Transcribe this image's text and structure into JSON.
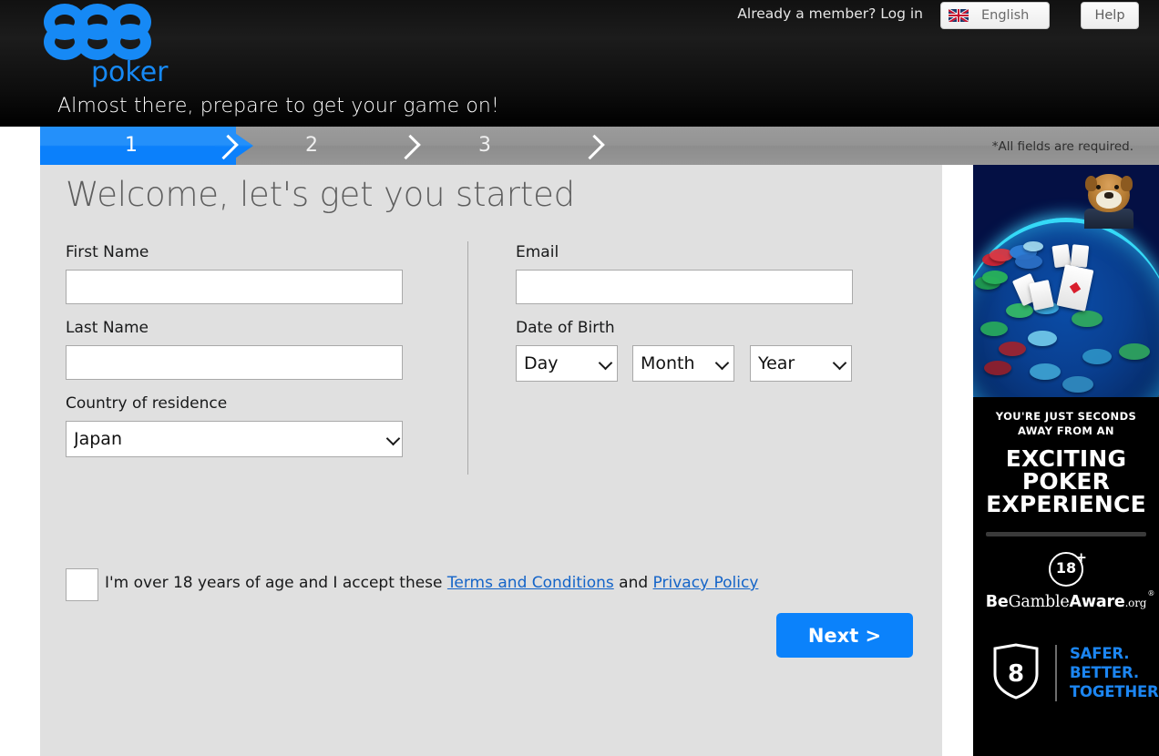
{
  "header": {
    "logo_digits": "888",
    "logo_word": "poker",
    "tagline": "Almost there, prepare to get your game on!",
    "member_prompt": "Already a member? Log in",
    "language": "English",
    "help": "Help"
  },
  "steps": {
    "items": [
      "1",
      "2",
      "3"
    ],
    "active_index": 0,
    "required_note": "*All fields are required."
  },
  "main": {
    "title": "Welcome, let's get you started",
    "fields": {
      "first_name": {
        "label": "First Name",
        "value": "",
        "placeholder": ""
      },
      "last_name": {
        "label": "Last Name",
        "value": "",
        "placeholder": ""
      },
      "country": {
        "label": "Country of residence",
        "value": "Japan"
      },
      "email": {
        "label": "Email",
        "value": "",
        "placeholder": ""
      },
      "dob": {
        "label": "Date of Birth",
        "day": "Day",
        "month": "Month",
        "year": "Year"
      }
    },
    "terms": {
      "text_before": "I'm over 18 years of age and I accept these ",
      "link_terms": "Terms and Conditions",
      "text_between": " and ",
      "link_privacy": "Privacy Policy",
      "checked": false
    },
    "next_label": "Next >"
  },
  "banner": {
    "copy_line1": "YOU'RE JUST SECONDS",
    "copy_line2": "AWAY FROM AN",
    "copy_big_1": "EXCITING",
    "copy_big_2": "POKER",
    "copy_big_3": "EXPERIENCE",
    "age_badge": "18",
    "age_badge_plus": "+",
    "bga_be": "Be",
    "bga_gamble": "Gamble",
    "bga_aware": "Aware",
    "bga_org": ".org",
    "bga_reg": "®",
    "safer_1": "SAFER.",
    "safer_2": "BETTER.",
    "safer_3": "TOGETHER.",
    "shield_number": "8"
  },
  "colors": {
    "brand_blue": "#0b82fb",
    "logo_blue": "#1689f5",
    "panel_bg": "#e0e0e0",
    "steps_grey": "#949494",
    "link_blue": "#1464c8"
  }
}
